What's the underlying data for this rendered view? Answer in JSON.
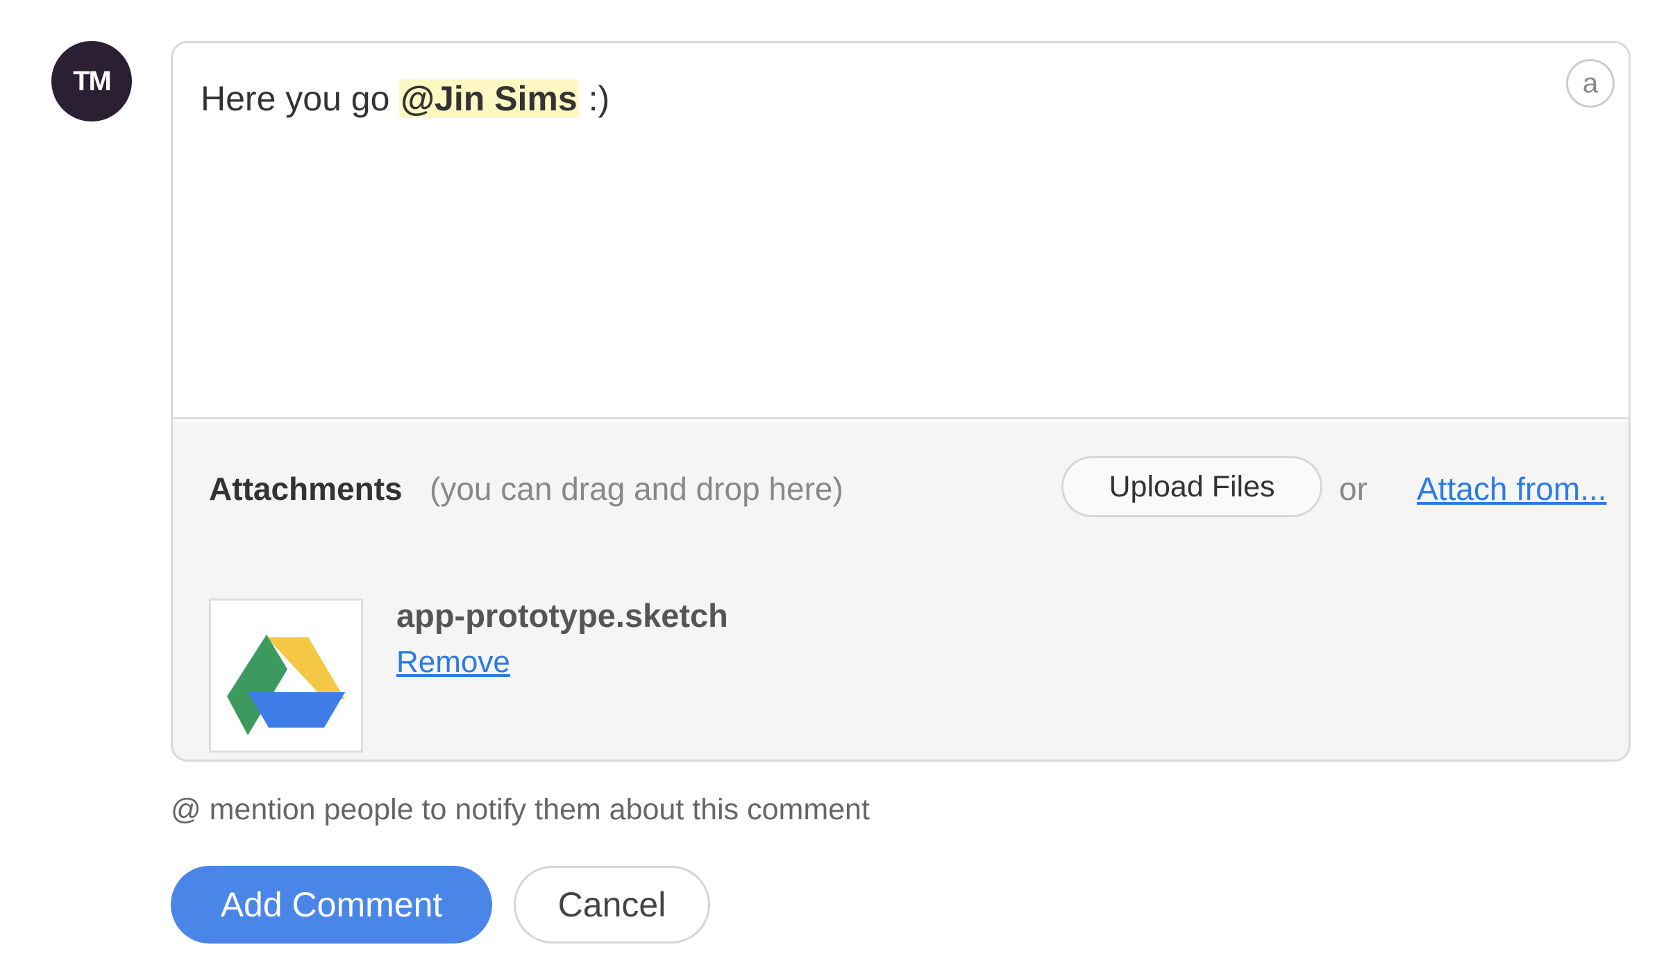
{
  "user": {
    "avatar_initials": "TM",
    "avatar_color": "#2b1f33"
  },
  "editor": {
    "text_before": "Here you go ",
    "mention": "@Jin Sims",
    "text_after": " :)",
    "format_button_label": "a"
  },
  "attachments": {
    "title": "Attachments",
    "hint": "(you can drag and drop here)",
    "upload_label": "Upload Files",
    "or_label": "or",
    "attach_from_label": "Attach from...",
    "files": [
      {
        "name": "app-prototype.sketch",
        "icon": "google-drive-icon",
        "remove_label": "Remove"
      }
    ]
  },
  "helper_text": "@ mention people to notify them about this comment",
  "actions": {
    "submit_label": "Add Comment",
    "cancel_label": "Cancel"
  },
  "colors": {
    "primary": "#4a86e8",
    "link": "#2c7be5",
    "mention_highlight": "#fff8c4"
  }
}
